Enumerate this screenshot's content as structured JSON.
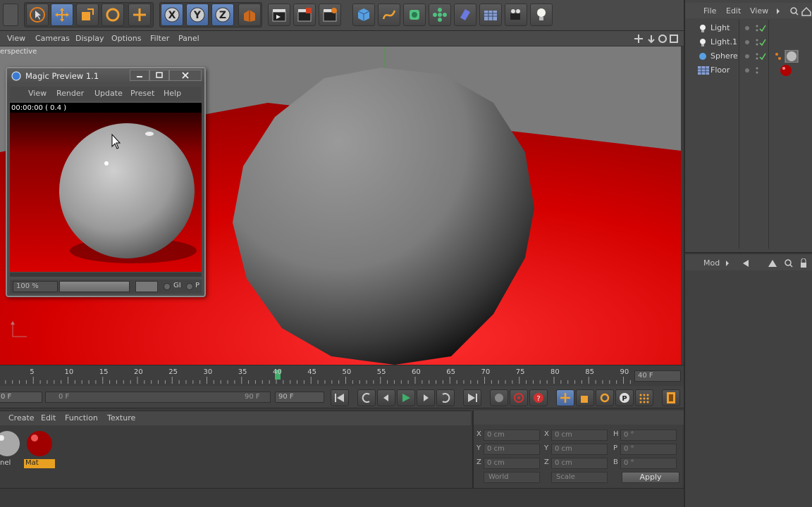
{
  "viewport": {
    "menu": [
      "View",
      "Cameras",
      "Display",
      "Options",
      "Filter",
      "Panel"
    ],
    "label": "erspective"
  },
  "magic_preview": {
    "title": "Magic Preview 1.1",
    "menu": [
      "View",
      "Render",
      "Update",
      "Preset",
      "Help"
    ],
    "timecode": "00:00:00 ( 0.4 )",
    "zoom": "100 %",
    "gi_label": "GI",
    "p_label": "P"
  },
  "object_manager": {
    "menu": [
      "File",
      "Edit",
      "View"
    ],
    "objects": [
      {
        "name": "Light",
        "icon": "light-icon"
      },
      {
        "name": "Light.1",
        "icon": "light-icon"
      },
      {
        "name": "Sphere",
        "icon": "sphere-icon"
      },
      {
        "name": "Floor",
        "icon": "floor-icon"
      }
    ]
  },
  "attribute_manager": {
    "mode_label": "Mod"
  },
  "timeline": {
    "ticks": [
      "5",
      "10",
      "15",
      "20",
      "25",
      "30",
      "35",
      "40",
      "45",
      "50",
      "55",
      "60",
      "65",
      "70",
      "75",
      "80",
      "85",
      "90"
    ],
    "current_frame": "40 F"
  },
  "transport": {
    "start_field": "0 F",
    "range_start": "0 F",
    "range_end": "90 F",
    "end_field": "90 F"
  },
  "materials": {
    "menu": [
      "Create",
      "Edit",
      "Function",
      "Texture"
    ],
    "items": [
      {
        "name": "nel"
      },
      {
        "name": "Mat"
      }
    ]
  },
  "coordinates": {
    "rows": [
      {
        "pos_label": "X",
        "pos_value": "0 cm",
        "size_label": "X",
        "size_value": "0 cm",
        "rot_label": "H",
        "rot_value": "0 °"
      },
      {
        "pos_label": "Y",
        "pos_value": "0 cm",
        "size_label": "Y",
        "size_value": "0 cm",
        "rot_label": "P",
        "rot_value": "0 °"
      },
      {
        "pos_label": "Z",
        "pos_value": "0 cm",
        "size_label": "Z",
        "size_value": "0 cm",
        "rot_label": "B",
        "rot_value": "0 °"
      }
    ],
    "space_select": "World",
    "mode_select": "Scale",
    "apply_label": "Apply"
  },
  "colors": {
    "floor_red": "#c40000",
    "accent_blue": "#3a7bd5",
    "material_highlight": "#e8a020"
  }
}
